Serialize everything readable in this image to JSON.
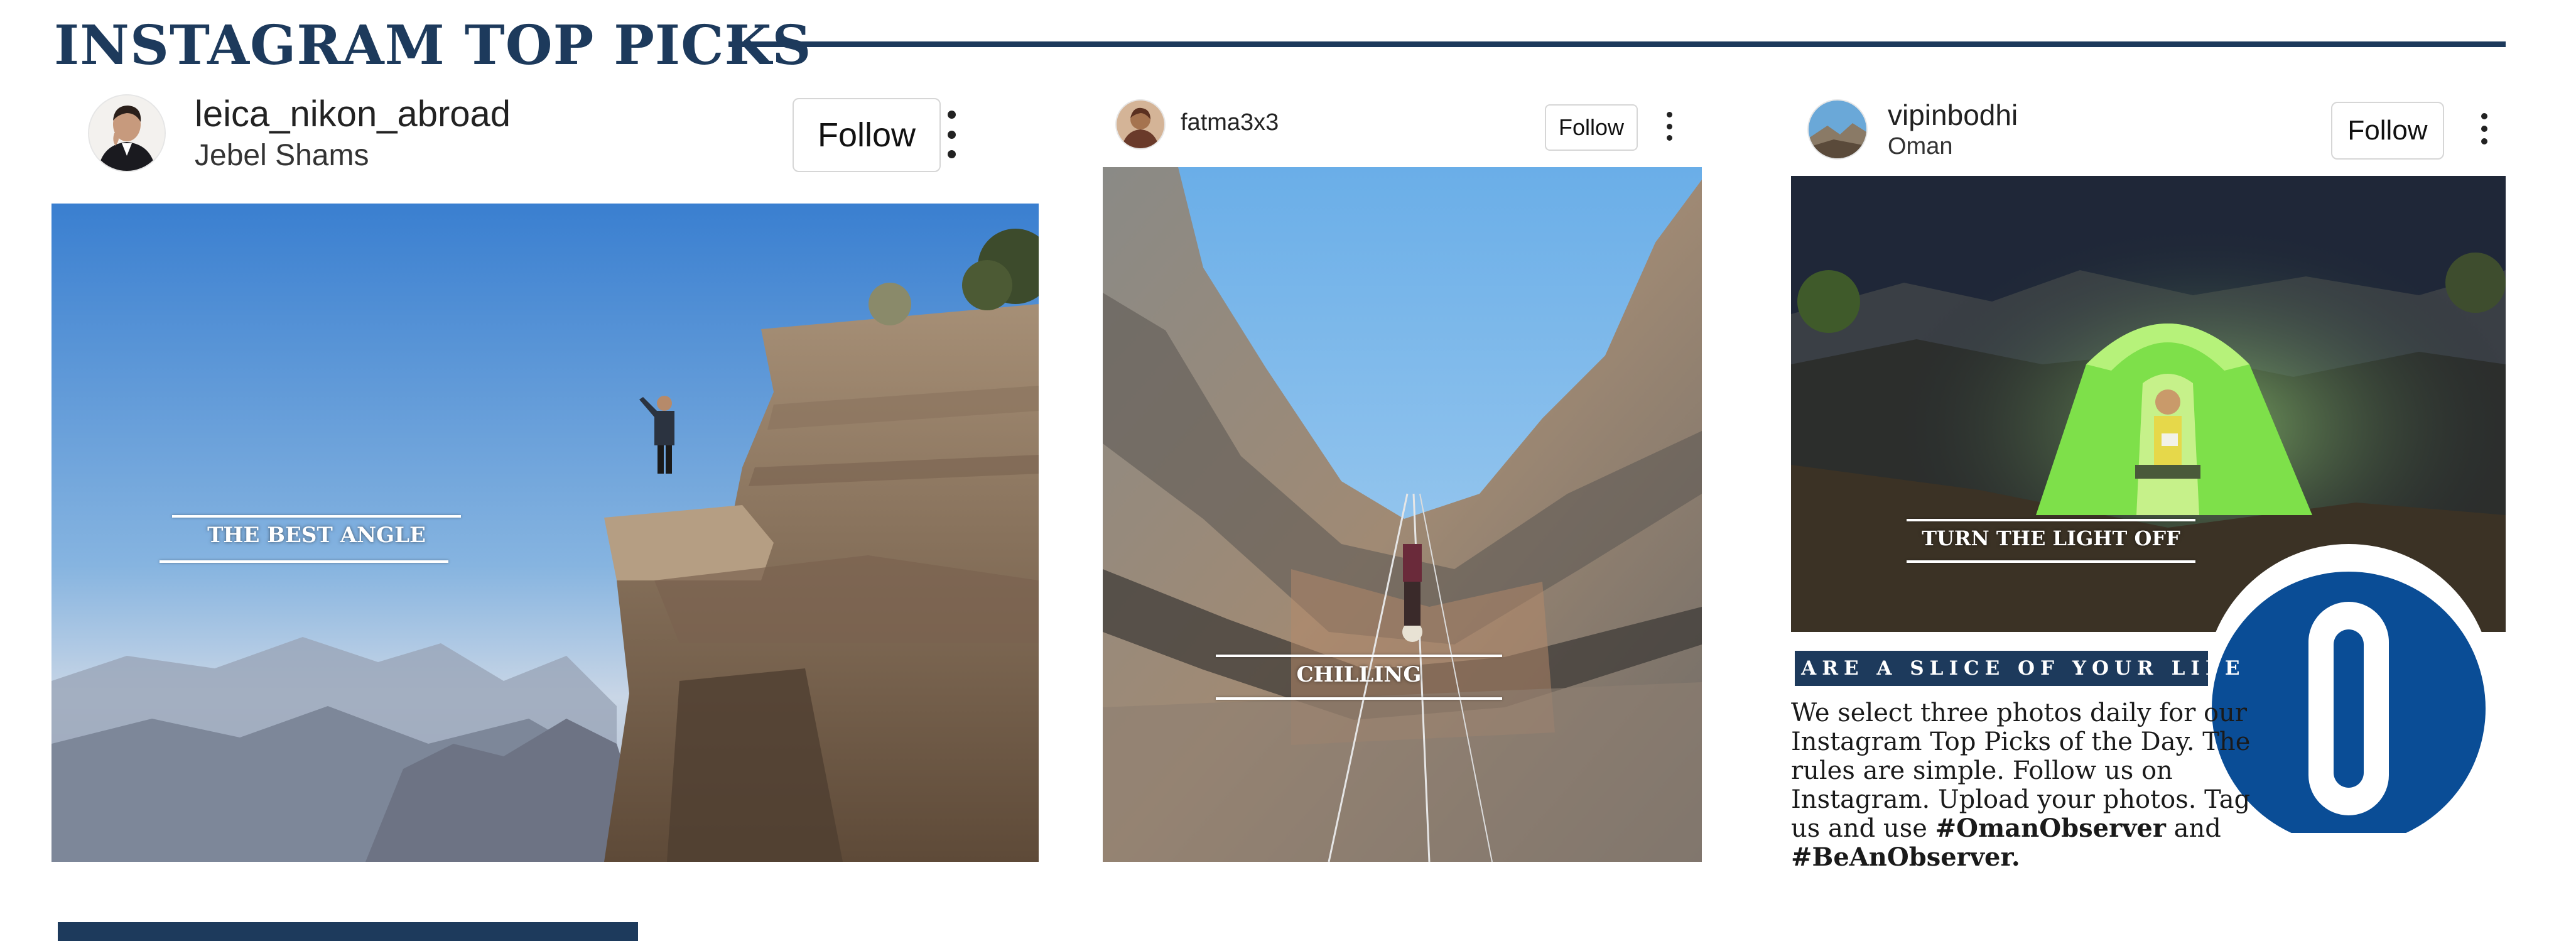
{
  "header": {
    "title": "INSTAGRAM TOP PICKS"
  },
  "posts": [
    {
      "username": "leica_nikon_abroad",
      "location": "Jebel Shams",
      "follow_label": "Follow",
      "caption": "THE BEST ANGLE"
    },
    {
      "username": "fatma3x3",
      "location": "",
      "follow_label": "Follow",
      "caption": "CHILLING"
    },
    {
      "username": "vipinbodhi",
      "location": "Oman",
      "follow_label": "Follow",
      "caption": "TURN THE LIGHT OFF"
    }
  ],
  "promo": {
    "banner": "SHARE A SLICE OF YOUR LIFE",
    "text": "We select three photos daily for our Instagram Top Picks of the Day. The rules are simple. Follow us on Instagram. Upload your photos. Tag us and use",
    "hashtag1": "#OmanObserver",
    "conjunction": "and",
    "hashtag2": "#BeAnObserver.",
    "logo_letter": "O"
  },
  "colors": {
    "navy": "#1d3a5c",
    "logo_blue": "#0a4d96",
    "tent_green": "#7ee04a"
  },
  "icons": [
    "more-options-icon",
    "avatar-portrait",
    "observer-logo"
  ]
}
